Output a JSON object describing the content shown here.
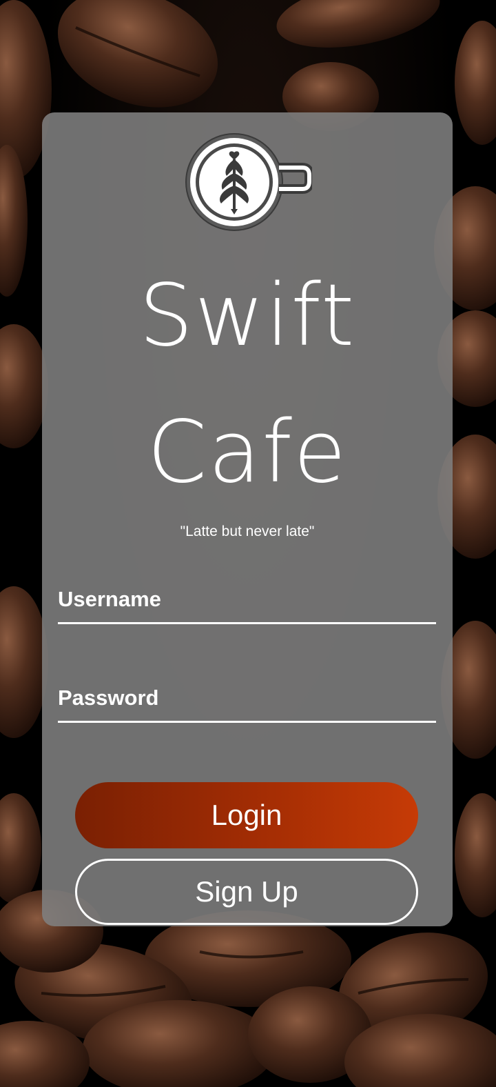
{
  "app": {
    "title_line1": "Swift",
    "title_line2": "Cafe",
    "tagline": "\"Latte but never late\""
  },
  "form": {
    "username_placeholder": "Username",
    "password_placeholder": "Password",
    "login_label": "Login",
    "signup_label": "Sign Up"
  },
  "colors": {
    "login_gradient_start": "#7a2003",
    "login_gradient_end": "#c63b06",
    "card_overlay": "#808080",
    "text": "#ffffff"
  },
  "icons": {
    "logo": "latte-art-cup-icon"
  }
}
